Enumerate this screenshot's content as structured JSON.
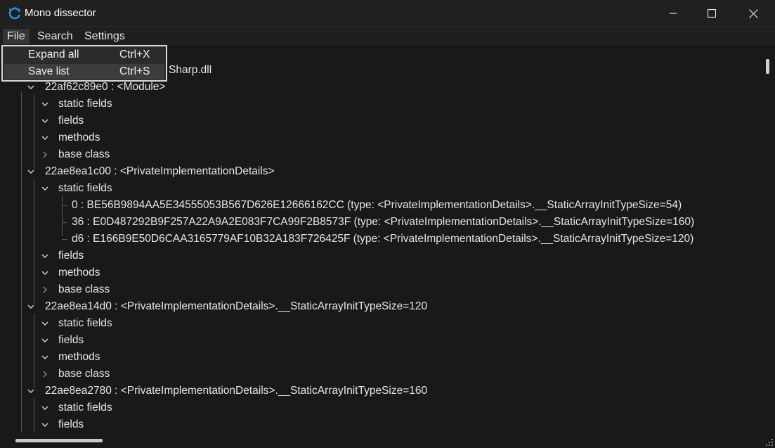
{
  "window": {
    "title": "Mono dissector"
  },
  "menubar": {
    "items": [
      "File",
      "Search",
      "Settings"
    ]
  },
  "file_menu": {
    "items": [
      {
        "label": "Expand all",
        "shortcut": "Ctrl+X"
      },
      {
        "label": "Save list",
        "shortcut": "Ctrl+S"
      }
    ]
  },
  "tree": {
    "rows": [
      {
        "text": "Sharp.dll",
        "expanded": true
      },
      {
        "text": "22af62c89e0 : <Module>",
        "expanded": true
      },
      {
        "text": "static fields",
        "expanded": true
      },
      {
        "text": "fields",
        "expanded": true
      },
      {
        "text": "methods",
        "expanded": true
      },
      {
        "text": "base class",
        "expanded": false
      },
      {
        "text": "22ae8ea1c00 : <PrivateImplementationDetails>",
        "expanded": true
      },
      {
        "text": "static fields",
        "expanded": true
      },
      {
        "text": "0 : BE56B9894AA5E34555053B567D626E12666162CC (type: <PrivateImplementationDetails>.__StaticArrayInitTypeSize=54)",
        "expanded": null
      },
      {
        "text": "36 : E0D487292B9F257A22A9A2E083F7CA99F2B8573F (type: <PrivateImplementationDetails>.__StaticArrayInitTypeSize=160)",
        "expanded": null
      },
      {
        "text": "d6 : E166B9E50D6CAA3165779AF10B32A183F726425F (type: <PrivateImplementationDetails>.__StaticArrayInitTypeSize=120)",
        "expanded": null
      },
      {
        "text": "fields",
        "expanded": true
      },
      {
        "text": "methods",
        "expanded": true
      },
      {
        "text": "base class",
        "expanded": false
      },
      {
        "text": "22ae8ea14d0 : <PrivateImplementationDetails>.__StaticArrayInitTypeSize=120",
        "expanded": true
      },
      {
        "text": "static fields",
        "expanded": true
      },
      {
        "text": "fields",
        "expanded": true
      },
      {
        "text": "methods",
        "expanded": true
      },
      {
        "text": "base class",
        "expanded": false
      },
      {
        "text": "22ae8ea2780 : <PrivateImplementationDetails>.__StaticArrayInitTypeSize=160",
        "expanded": true
      },
      {
        "text": "static fields",
        "expanded": true
      },
      {
        "text": "fields",
        "expanded": true
      }
    ]
  }
}
